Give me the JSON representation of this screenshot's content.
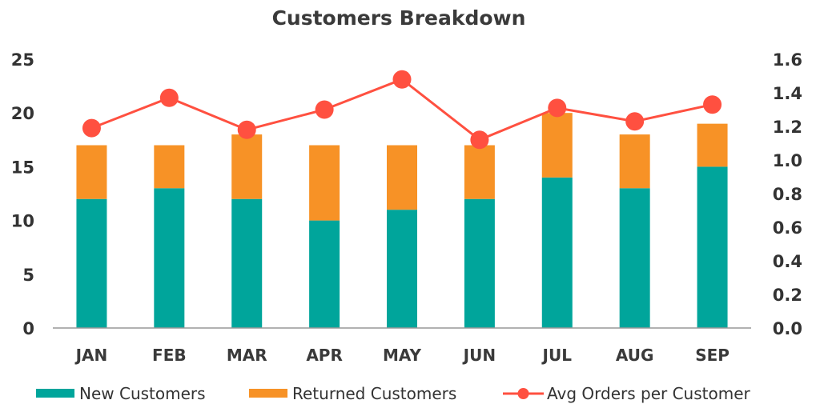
{
  "chart_data": {
    "type": "bar",
    "stacked": true,
    "title": "Customers Breakdown",
    "xlabel": "",
    "ylabel": "",
    "y2label": "",
    "categories": [
      "JAN",
      "FEB",
      "MAR",
      "APR",
      "MAY",
      "JUN",
      "JUL",
      "AUG",
      "SEP"
    ],
    "series": [
      {
        "name": "New Customers",
        "type": "bar",
        "axis": "left",
        "color": "#00A59B",
        "values": [
          12,
          13,
          12,
          10,
          11,
          12,
          14,
          13,
          15
        ]
      },
      {
        "name": "Returned Customers",
        "type": "bar",
        "axis": "left",
        "color": "#F79226",
        "values": [
          5,
          4,
          6,
          7,
          6,
          5,
          6,
          5,
          4
        ]
      },
      {
        "name": "Avg Orders per Customer",
        "type": "line",
        "axis": "right",
        "color": "#FF5040",
        "values": [
          1.19,
          1.37,
          1.18,
          1.3,
          1.48,
          1.12,
          1.31,
          1.23,
          1.33
        ]
      }
    ],
    "ylim": [
      0,
      25
    ],
    "yticks": [
      "0",
      "5",
      "10",
      "15",
      "20",
      "25"
    ],
    "y2lim": [
      0,
      1.6
    ],
    "y2ticks": [
      "0.0",
      "0.2",
      "0.4",
      "0.6",
      "0.8",
      "1.0",
      "1.2",
      "1.4",
      "1.6"
    ],
    "grid": false,
    "legend": "bottom"
  }
}
